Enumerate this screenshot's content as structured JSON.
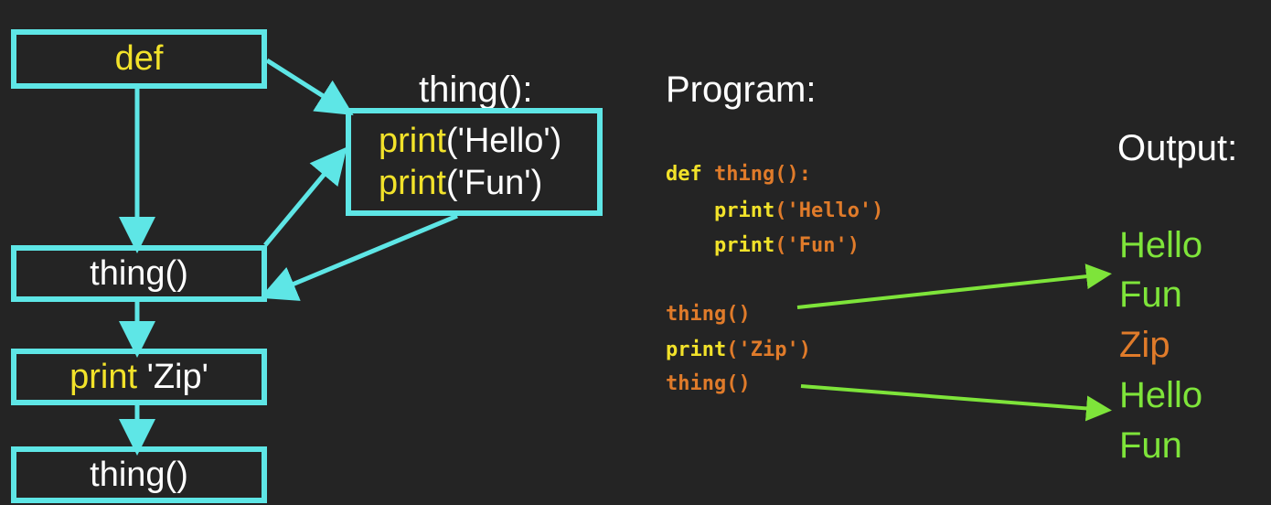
{
  "flowchart": {
    "def_label": "def",
    "call1_label": "thing()",
    "zip_kw": "print",
    "zip_arg": " 'Zip'",
    "call2_label": "thing()",
    "signature": "thing():",
    "body": [
      {
        "kw": "print",
        "arg": "('Hello')"
      },
      {
        "kw": "print",
        "arg": "('Fun')"
      }
    ]
  },
  "program": {
    "title": "Program:",
    "line1_kw": "def ",
    "line1_name": "thing():",
    "line2_kw": "    print",
    "line2_arg": "('Hello')",
    "line3_kw": "    print",
    "line3_arg": "('Fun')",
    "line5": "thing()",
    "line6_kw": "print",
    "line6_arg": "('Zip')",
    "line7": "thing()"
  },
  "output": {
    "title": "Output:",
    "lines": [
      "Hello",
      "Fun",
      "Zip",
      "Hello",
      "Fun"
    ]
  },
  "colors": {
    "flow_arrow": "#5ee6e6",
    "output_arrow": "#7ee43a",
    "keyword": "#f2e22a",
    "code_orange": "#e07b2a",
    "output_green": "#7ee43a"
  }
}
